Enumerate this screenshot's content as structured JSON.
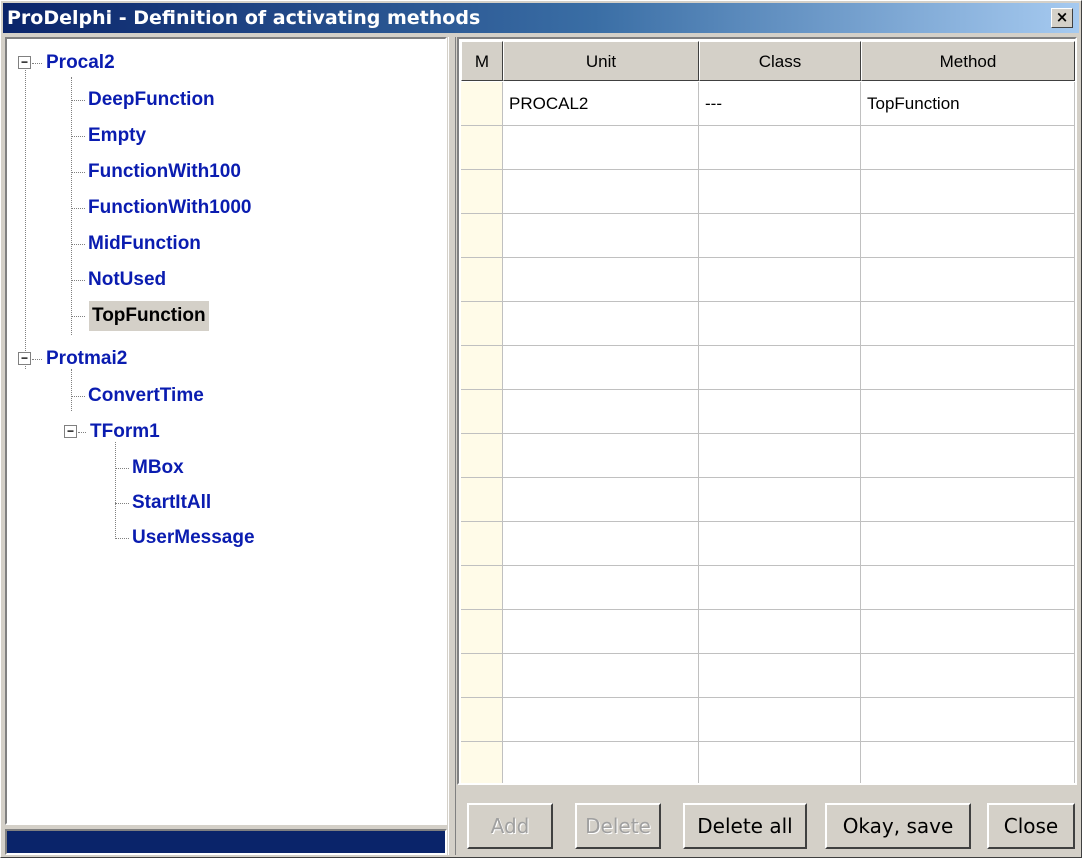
{
  "window": {
    "title": "ProDelphi - Definition of activating methods",
    "close_glyph": "×"
  },
  "tree": {
    "units": [
      {
        "label": "Procal2",
        "expanded": true,
        "children": [
          {
            "label": "DeepFunction"
          },
          {
            "label": "Empty"
          },
          {
            "label": "FunctionWith100"
          },
          {
            "label": "FunctionWith1000"
          },
          {
            "label": "MidFunction"
          },
          {
            "label": "NotUsed"
          },
          {
            "label": "TopFunction",
            "selected": true
          }
        ]
      },
      {
        "label": "Protmai2",
        "expanded": true,
        "children": [
          {
            "label": "ConvertTime"
          },
          {
            "label": "TForm1",
            "expanded": true,
            "children": [
              {
                "label": "MBox"
              },
              {
                "label": "StartItAll"
              },
              {
                "label": "UserMessage"
              }
            ]
          }
        ]
      }
    ],
    "expander_minus": "−"
  },
  "grid": {
    "columns": [
      "M",
      "Unit",
      "Class",
      "Method"
    ],
    "rows": [
      {
        "m": "",
        "unit": "PROCAL2",
        "class": "---",
        "method": "TopFunction"
      }
    ],
    "empty_row_count": 15
  },
  "buttons": {
    "add": {
      "label": "Add",
      "enabled": false
    },
    "delete": {
      "label": "Delete",
      "enabled": false
    },
    "delete_all": {
      "label": "Delete all",
      "enabled": true
    },
    "okay_save": {
      "label": "Okay, save",
      "enabled": true
    },
    "close": {
      "label": "Close",
      "enabled": true
    }
  },
  "colors": {
    "tree_text": "#0a1cb0",
    "title_bar": "#0a246a",
    "status_bar": "#0a246a"
  }
}
